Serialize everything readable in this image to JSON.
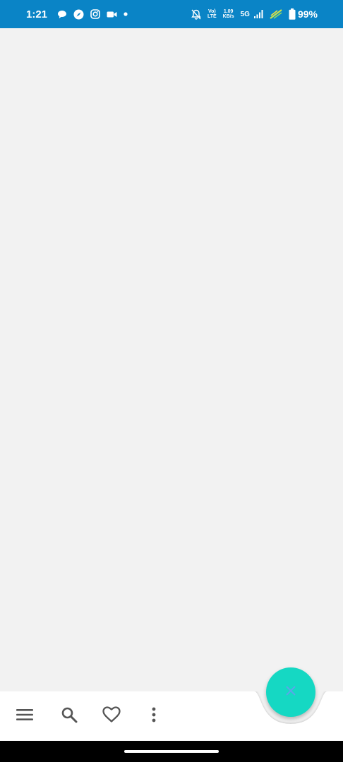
{
  "status_bar": {
    "time": "1:21",
    "volte_top": "Vo)",
    "volte_bottom": "LTE",
    "speed_value": "1.09",
    "speed_unit": "KB/s",
    "network_type": "5G",
    "battery_percent": "99%",
    "notification_icons": [
      "chat-bubble-icon",
      "compass-icon",
      "instagram-icon",
      "video-camera-icon",
      "dot-icon"
    ],
    "system_icons": [
      "bell-off-icon",
      "signal-icon",
      "charging-icon",
      "battery-icon"
    ]
  },
  "bottom_bar": {
    "actions": [
      "menu-icon",
      "search-icon",
      "heart-icon",
      "more-vert-icon"
    ],
    "fab_icon": "close-icon"
  },
  "colors": {
    "status_bar": "#0a84c6",
    "background": "#f2f2f2",
    "bottom_bar": "#ffffff",
    "fab": "#15d8c3",
    "fab_icon": "#5aa7e8",
    "nav_icons": "#555555"
  }
}
